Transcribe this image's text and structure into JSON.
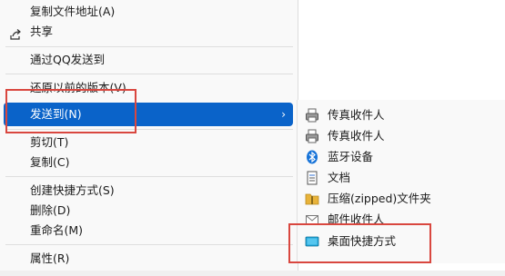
{
  "main_menu": {
    "items": [
      {
        "label": "复制文件地址(A)"
      },
      {
        "label": "共享"
      },
      {
        "label": "通过QQ发送到"
      },
      {
        "label": "还原以前的版本(V)"
      },
      {
        "label": "发送到(N)"
      },
      {
        "label": "剪切(T)"
      },
      {
        "label": "复制(C)"
      },
      {
        "label": "创建快捷方式(S)"
      },
      {
        "label": "删除(D)"
      },
      {
        "label": "重命名(M)"
      },
      {
        "label": "属性(R)"
      }
    ],
    "chevron": "›"
  },
  "send_to_menu": {
    "items": [
      {
        "label": "传真收件人",
        "icon": "fax-icon"
      },
      {
        "label": "传真收件人",
        "icon": "fax-icon"
      },
      {
        "label": "蓝牙设备",
        "icon": "bluetooth-icon"
      },
      {
        "label": "文档",
        "icon": "document-icon"
      },
      {
        "label": "压缩(zipped)文件夹",
        "icon": "zip-folder-icon"
      },
      {
        "label": "邮件收件人",
        "icon": "mail-icon"
      },
      {
        "label": "桌面快捷方式",
        "icon": "desktop-icon"
      }
    ]
  },
  "colors": {
    "selection": "#0a63c9",
    "annotation": "#d9473f",
    "bluetooth": "#1773d8",
    "folder": "#e8b33a"
  }
}
